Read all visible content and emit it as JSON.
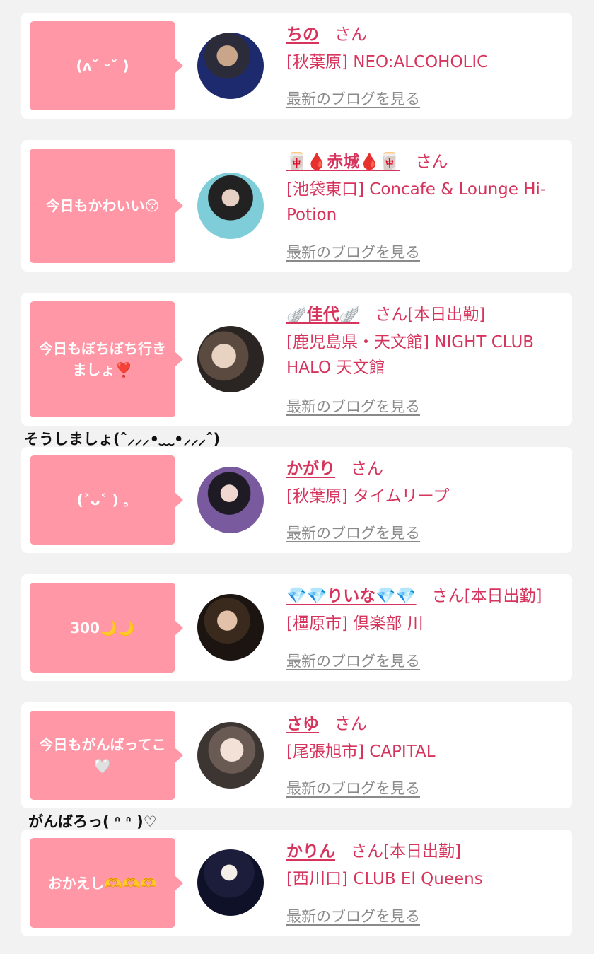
{
  "san_label": "さん",
  "blog_link": "最新のブログを見る",
  "colors": {
    "accent": "#d6345c",
    "bubble": "#ff97a6",
    "background": "#f2f2f2",
    "link_gray": "#8a8a8a"
  },
  "entries": [
    {
      "comment": "(ʌ˘ ᵕ˘ )",
      "name": "ちの",
      "today": "",
      "shop": "[秋葉原] NEO:ALCOHOLIC",
      "reply": ""
    },
    {
      "comment": "今日もかわいい😚",
      "name": "🀄🩸赤城🩸🀄",
      "today": "",
      "shop": "[池袋東口] Concafe & Lounge Hi-Potion",
      "reply": ""
    },
    {
      "comment": "今日もぼちぼち行きましょ❣️",
      "name": "🪽佳代🪽",
      "today": "[本日出勤]",
      "shop": "[鹿児島県・天文館] NIGHT CLUB HALO 天文館",
      "reply": "そうしましょ(ˆ⸝⸝⸝•﹏•⸝⸝⸝ˆ)"
    },
    {
      "comment": "(˃ᴗ˂ ) ꜆",
      "name": "かがり",
      "today": "",
      "shop": "[秋葉原] タイムリープ",
      "reply": ""
    },
    {
      "comment": "300🌙🌙",
      "name": "💎💎りいな💎💎",
      "today": "[本日出勤]",
      "shop": "[橿原市] 倶楽部 川",
      "reply": ""
    },
    {
      "comment": "今日もがんばってこ🤍",
      "name": "さゆ",
      "today": "",
      "shop": "[尾張旭市] CAPITAL",
      "reply": "がんばろっ( ᐢ ᐢ )♡"
    },
    {
      "comment": "おかえし🫶🫶🫶",
      "name": "かりん",
      "today": "[本日出勤]",
      "shop": "[西川口] CLUB El Queens",
      "reply": ""
    }
  ]
}
